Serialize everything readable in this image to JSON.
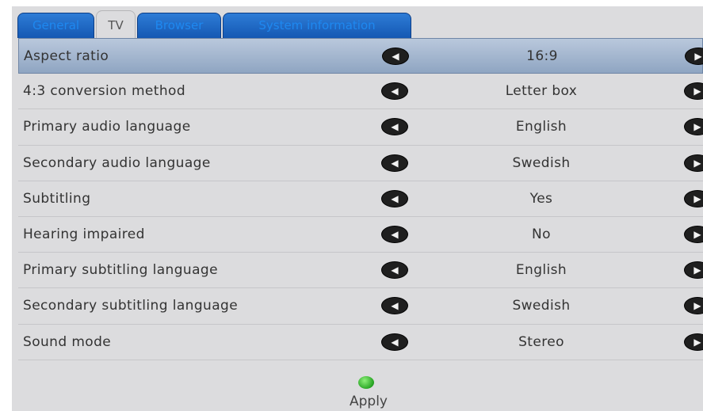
{
  "tabs": [
    {
      "label": "General"
    },
    {
      "label": "TV"
    },
    {
      "label": "Browser"
    },
    {
      "label": "System information"
    }
  ],
  "active_tab": "TV",
  "settings": [
    {
      "label": "Aspect ratio",
      "value": "16:9"
    },
    {
      "label": "4:3 conversion method",
      "value": "Letter box"
    },
    {
      "label": "Primary audio language",
      "value": "English"
    },
    {
      "label": "Secondary audio language",
      "value": "Swedish"
    },
    {
      "label": "Subtitling",
      "value": "Yes"
    },
    {
      "label": "Hearing impaired",
      "value": "No"
    },
    {
      "label": "Primary subtitling language",
      "value": "English"
    },
    {
      "label": "Secondary subtitling language",
      "value": "Swedish"
    },
    {
      "label": "Sound mode",
      "value": "Stereo"
    }
  ],
  "selected_setting": "Aspect ratio",
  "arrows": {
    "left": "◀",
    "right": "▶"
  },
  "apply": {
    "label": "Apply",
    "status_color": "#2fb52a"
  },
  "colors": {
    "tab_blue": "#1a62c0",
    "selection": "#a9bbd2",
    "panel": "#dcdcde"
  }
}
